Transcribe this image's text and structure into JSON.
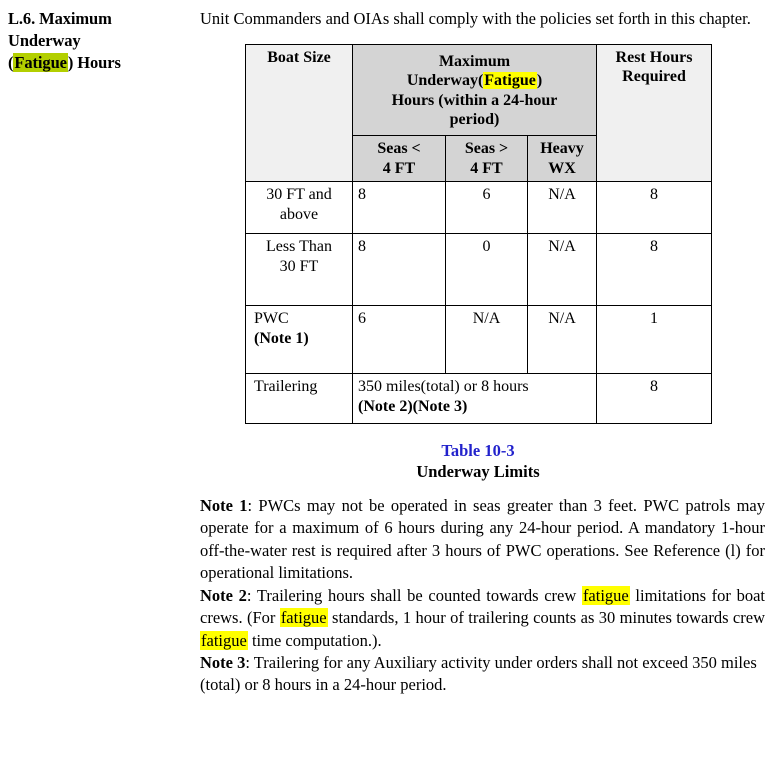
{
  "sidebar": {
    "heading_part1": "L.6. Maximum",
    "heading_part2": "Underway",
    "heading_open_paren": "(",
    "heading_highlight": "Fatigue",
    "heading_close": ") Hours"
  },
  "intro": {
    "paragraph": "Unit Commanders and OIAs shall comply with the policies set forth in this chapter."
  },
  "table": {
    "headers": {
      "boat_size": "Boat Size",
      "span_line1": "Maximum",
      "span_line2_pre": "Underway(",
      "span_line2_highlight": "Fatigue",
      "span_line2_post": ")",
      "span_line3": "Hours (within a 24-hour",
      "span_line4": "period)",
      "seas_lt_line1": "Seas <",
      "seas_lt_line2": "4 FT",
      "seas_gt_line1": "Seas >",
      "seas_gt_line2": "4 FT",
      "heavy_wx_line1": "Heavy",
      "heavy_wx_line2": "WX",
      "rest_line1": "Rest Hours",
      "rest_line2": "Required"
    },
    "rows": [
      {
        "label_line1": "30 FT and",
        "label_line2": "above",
        "seas_lt": "8",
        "seas_gt": "6",
        "heavy_wx": "N/A",
        "rest": "8"
      },
      {
        "label_line1": "Less Than",
        "label_line2": "30 FT",
        "seas_lt": "8",
        "seas_gt": "0",
        "heavy_wx": "N/A",
        "rest": "8"
      },
      {
        "label_line1": "PWC",
        "label_line2": "(Note 1)",
        "label_line2_bold": true,
        "seas_lt": "6",
        "seas_gt": "N/A",
        "heavy_wx": "N/A",
        "rest": "1"
      }
    ],
    "trailering_row": {
      "label": "Trailering",
      "text_line1": "350 miles(total) or 8 hours",
      "text_line2": "(Note 2)(Note 3)",
      "rest": "8"
    }
  },
  "caption": {
    "table_number": "Table 10-3",
    "table_title": "Underway Limits"
  },
  "notes": {
    "note1_label": "Note 1",
    "note1_text": ": PWCs may not be operated in seas greater than 3 feet.  PWC patrols may operate for a maximum of 6 hours during any 24-hour period.  A mandatory 1-hour off-the-water rest is required after 3 hours of PWC operations.  See Reference (l) for operational limitations.",
    "note2_label": "Note 2",
    "note2_seg1": ": Trailering hours shall be counted towards crew ",
    "note2_hl1": "fatigue",
    "note2_seg2": " limitations for boat crews. (For ",
    "note2_hl2": "fatigue",
    "note2_seg3": " standards, 1 hour of trailering counts as 30 minutes towards crew ",
    "note2_hl3": "fatigue",
    "note2_seg4": " time computation.).",
    "note3_label": "Note 3",
    "note3_text": ": Trailering for any Auxiliary activity under orders shall not exceed 350 miles (total) or 8 hours in a 24-hour period."
  },
  "colors": {
    "highlight_yellow": "#ffff00",
    "highlight_green": "#b3cf00",
    "table_number_blue": "#2222cc",
    "header_light_gray": "#f0f0f0",
    "header_dark_gray": "#d4d4d4"
  }
}
